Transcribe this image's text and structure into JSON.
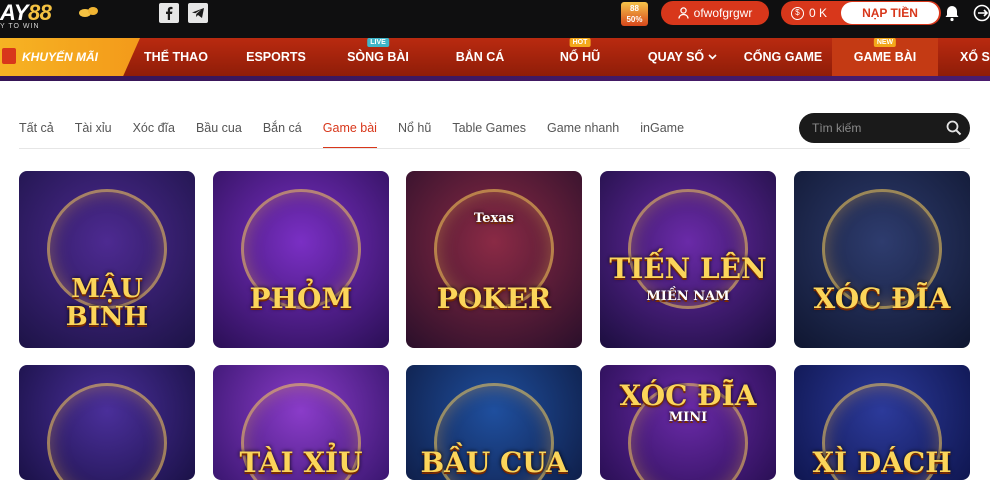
{
  "header": {
    "logo_main": "AY",
    "logo_num": "88",
    "logo_sub": "Y TO WIN",
    "promo_badge": "88\n50%",
    "username": "ofwofgrgwr",
    "balance": "0 K",
    "deposit_label": "NẠP TIỀN"
  },
  "nav": {
    "promo_label": "KHUYẾN MÃI",
    "items": [
      {
        "label": "THỂ THAO",
        "badge": ""
      },
      {
        "label": "ESPORTS",
        "badge": ""
      },
      {
        "label": "SÒNG BÀI",
        "badge": "LIVE"
      },
      {
        "label": "BẮN CÁ",
        "badge": ""
      },
      {
        "label": "NỔ HŨ",
        "badge": "HOT"
      },
      {
        "label": "QUAY SỐ",
        "badge": ""
      },
      {
        "label": "CỔNG GAME",
        "badge": ""
      },
      {
        "label": "GAME BÀI",
        "badge": "NEW"
      },
      {
        "label": "XỔ SỐ",
        "badge": ""
      }
    ]
  },
  "filters": {
    "tabs": [
      "Tất cả",
      "Tài xỉu",
      "Xóc đĩa",
      "Bầu cua",
      "Bắn cá",
      "Game bài",
      "Nổ hũ",
      "Table Games",
      "Game nhanh",
      "inGame"
    ],
    "active": "Game bài",
    "search_placeholder": "Tìm kiếm"
  },
  "games": [
    {
      "title": "MẬU\nBINH",
      "bg1": "#4d2a91",
      "bg2": "#1c1346"
    },
    {
      "title": "PHỎM",
      "bg1": "#7a2fc4",
      "bg2": "#2a0f55"
    },
    {
      "title": "POKER",
      "subtitle": "Texas",
      "bg1": "#8a2a45",
      "bg2": "#2a0f2a"
    },
    {
      "title": "TIẾN LÊN",
      "subtitle": "MIỀN NAM",
      "bg1": "#6a2aa8",
      "bg2": "#1b0e3e"
    },
    {
      "title": "XÓC ĐĨA",
      "bg1": "#2e3c6e",
      "bg2": "#0f1630"
    },
    {
      "title": "",
      "bg1": "#4a2f9a",
      "bg2": "#1a1147"
    },
    {
      "title": "TÀI XỈU",
      "bg1": "#8a3cc9",
      "bg2": "#3a1670"
    },
    {
      "title": "BẦU CUA",
      "bg1": "#1f4f9e",
      "bg2": "#0f1f4a"
    },
    {
      "title": "XÓC ĐĨA",
      "subtitle": "MINI",
      "bg1": "#6a2aa8",
      "bg2": "#2a0f55"
    },
    {
      "title": "XÌ DÁCH",
      "bg1": "#2c3a9a",
      "bg2": "#0f1650"
    }
  ]
}
